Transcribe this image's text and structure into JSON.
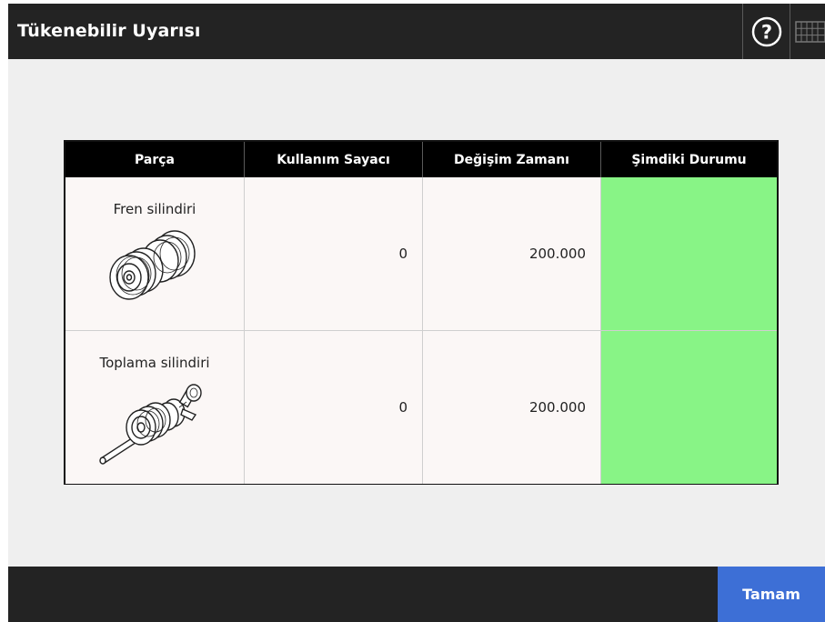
{
  "window": {
    "title": "Tükenebilir Uyarısı"
  },
  "toolbar": {
    "help_icon": "help-icon",
    "keyboard_icon": "keyboard-icon"
  },
  "table": {
    "columns": [
      "Parça",
      "Kullanım Sayacı",
      "Değişim Zamanı",
      "Şimdiki Durumu"
    ],
    "rows": [
      {
        "part": "Fren silindiri",
        "image": "brake-roller-icon",
        "usage_counter": "0",
        "replacement_time": "200.000",
        "status_color": "#88f486"
      },
      {
        "part": "Toplama silindiri",
        "image": "pick-roller-icon",
        "usage_counter": "0",
        "replacement_time": "200.000",
        "status_color": "#88f486"
      }
    ]
  },
  "footer": {
    "ok_label": "Tamam",
    "ok_color": "#3d6fd6"
  }
}
